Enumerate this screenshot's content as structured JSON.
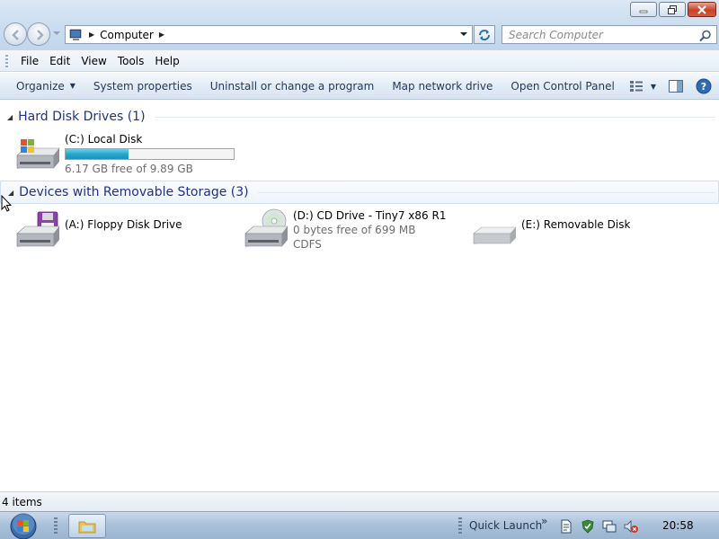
{
  "window": {
    "title_buttons": [
      "minimize-icon",
      "restore-icon",
      "close-icon"
    ]
  },
  "address_bar": {
    "crumbs": [
      "Computer"
    ]
  },
  "search": {
    "placeholder": "Search Computer"
  },
  "menu": {
    "items": [
      "File",
      "Edit",
      "View",
      "Tools",
      "Help"
    ]
  },
  "command_bar": {
    "organize": "Organize",
    "system_properties": "System properties",
    "uninstall": "Uninstall or change a program",
    "map_drive": "Map network drive",
    "control_panel": "Open Control Panel"
  },
  "groups": {
    "hard_disks": {
      "title": "Hard Disk Drives (1)",
      "drives": [
        {
          "name": "(C:) Local Disk",
          "free_text": "6.17 GB free of 9.89 GB",
          "used_fraction": 0.376
        }
      ]
    },
    "removable": {
      "title": "Devices with Removable Storage (3)",
      "drives": [
        {
          "name": "(A:) Floppy Disk Drive"
        },
        {
          "name": "(D:) CD Drive - Tiny7 x86 R1",
          "free_text": "0 bytes free of 699 MB",
          "fs": "CDFS"
        },
        {
          "name": "(E:) Removable Disk"
        }
      ]
    }
  },
  "status": {
    "items": "4 items"
  },
  "taskbar": {
    "quick_launch": "Quick Launch",
    "chevron": "»",
    "clock": "20:58"
  },
  "colors": {
    "accent_title": "#1e3287",
    "capacity_fill": "#25a7cf"
  }
}
